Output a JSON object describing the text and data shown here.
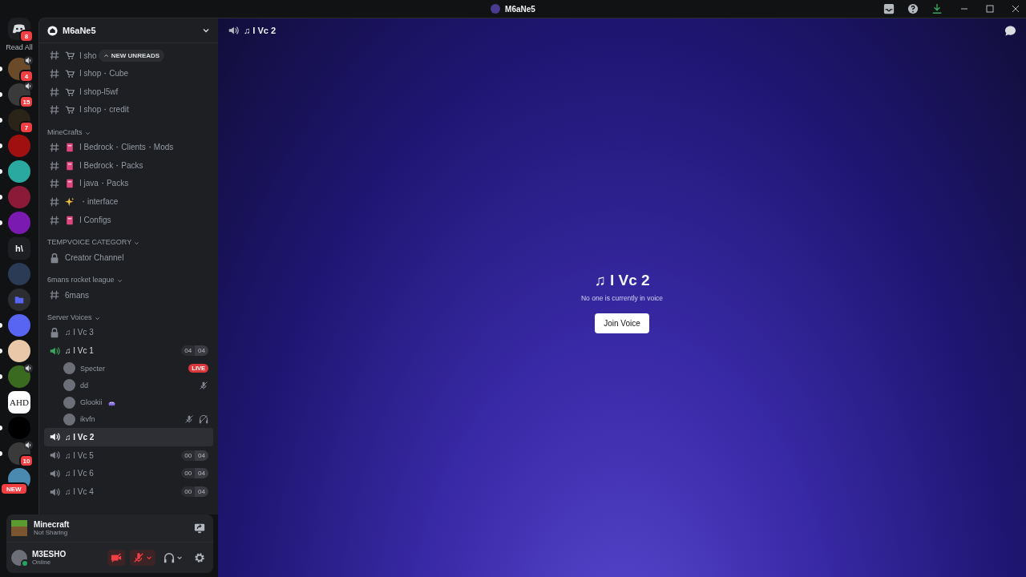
{
  "window": {
    "title": "M6aNe5"
  },
  "servers_home": {
    "label": "Read All",
    "badge": "8"
  },
  "servers": [
    {
      "kind": "image",
      "color": "#6b4a2a",
      "badge": "4",
      "voice": true,
      "unread": true
    },
    {
      "kind": "image",
      "color": "#3a3a3a",
      "badge": "15",
      "voice": true,
      "unread": true
    },
    {
      "kind": "image",
      "color": "#2a2418",
      "badge": "7",
      "unread": true
    },
    {
      "kind": "image",
      "color": "#a01010",
      "unread": true
    },
    {
      "kind": "image",
      "color": "#2aa9a0",
      "unread": true
    },
    {
      "kind": "image",
      "color": "#8a1a38",
      "unread": true
    },
    {
      "kind": "image",
      "color": "#7a1ab0",
      "unread": true
    },
    {
      "kind": "text",
      "label": "h\\",
      "color": "#1e1f22"
    },
    {
      "kind": "image",
      "color": "#2b3a55"
    },
    {
      "kind": "folder",
      "color": "#2b2d31"
    },
    {
      "kind": "image",
      "color": "#5865f2",
      "unread": true
    },
    {
      "kind": "image",
      "color": "#e8c8a8",
      "unread": true
    },
    {
      "kind": "image",
      "color": "#3a6a20",
      "voice": true,
      "unread": true
    },
    {
      "kind": "text",
      "label": "AHD",
      "color": "#ffffff"
    },
    {
      "kind": "image",
      "color": "#000000",
      "unread": true
    },
    {
      "kind": "image",
      "color": "#3a3a3a",
      "badge": "10",
      "voice": true,
      "unread": true
    },
    {
      "kind": "image",
      "color": "#4a8ab0",
      "badge": "NEW"
    }
  ],
  "guild": {
    "name": "M6aNe5",
    "unreads_pill": "NEW UNREADS"
  },
  "channel_groups": [
    {
      "channels": [
        {
          "kind": "text",
          "name": "I sho"
        },
        {
          "kind": "text",
          "name": "I shop・Cube"
        },
        {
          "kind": "text",
          "name": "I shop-l5wf"
        },
        {
          "kind": "text",
          "name": "I shop・credit"
        }
      ]
    },
    {
      "category": "MineCrafts",
      "channels": [
        {
          "kind": "text",
          "name": "I Bedrock・Clients・Mods"
        },
        {
          "kind": "text",
          "name": "I Bedrock・Packs"
        },
        {
          "kind": "text",
          "name": "I java・Packs"
        },
        {
          "kind": "text",
          "name": "・interface"
        },
        {
          "kind": "text",
          "name": "I Configs"
        }
      ]
    },
    {
      "category": "TEMPVOICE CATEGORY",
      "channels": [
        {
          "kind": "locked",
          "name": "Creator Channel"
        }
      ]
    },
    {
      "category": "6mans rocket league",
      "channels": [
        {
          "kind": "text",
          "name": "6mans"
        }
      ]
    },
    {
      "category": "Server Voices",
      "channels": [
        {
          "kind": "locked-voice",
          "name": "♫ I Vc 3",
          "selected": false
        },
        {
          "kind": "voice",
          "active": true,
          "name": "♫ I Vc 1",
          "count": "04",
          "limit": "04",
          "selected": false,
          "users": [
            {
              "name": "Specter",
              "live": "LIVE"
            },
            {
              "name": "dd",
              "muted": true
            },
            {
              "name": "Glookii",
              "emoji": true
            },
            {
              "name": "ikvfn",
              "muted": true,
              "deafened": true
            }
          ]
        },
        {
          "kind": "voice",
          "name": "♫ I Vc 2",
          "selected": true
        },
        {
          "kind": "voice",
          "name": "♫ I Vc 5",
          "count": "00",
          "limit": "04",
          "selected": false
        },
        {
          "kind": "voice",
          "name": "♫ I Vc 6",
          "count": "00",
          "limit": "04",
          "selected": false
        },
        {
          "kind": "voice",
          "name": "♫ I Vc 4",
          "count": "00",
          "limit": "04",
          "selected": false
        }
      ]
    }
  ],
  "activity": {
    "title": "Minecraft",
    "subtitle": "Not Sharing"
  },
  "user": {
    "name": "M3ESHO",
    "status": "Online",
    "camera_off": true,
    "mic_muted": true
  },
  "main": {
    "header": "♫ I Vc 2",
    "title": "♫ I Vc 2",
    "subtitle": "No one is currently in voice",
    "button": "Join Voice"
  }
}
